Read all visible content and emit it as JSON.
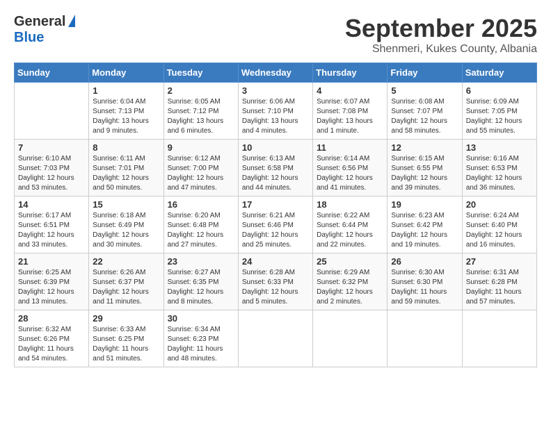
{
  "logo": {
    "general": "General",
    "blue": "Blue"
  },
  "title": "September 2025",
  "location": "Shenmeri, Kukes County, Albania",
  "weekdays": [
    "Sunday",
    "Monday",
    "Tuesday",
    "Wednesday",
    "Thursday",
    "Friday",
    "Saturday"
  ],
  "weeks": [
    [
      {
        "day": "",
        "info": ""
      },
      {
        "day": "1",
        "info": "Sunrise: 6:04 AM\nSunset: 7:13 PM\nDaylight: 13 hours\nand 9 minutes."
      },
      {
        "day": "2",
        "info": "Sunrise: 6:05 AM\nSunset: 7:12 PM\nDaylight: 13 hours\nand 6 minutes."
      },
      {
        "day": "3",
        "info": "Sunrise: 6:06 AM\nSunset: 7:10 PM\nDaylight: 13 hours\nand 4 minutes."
      },
      {
        "day": "4",
        "info": "Sunrise: 6:07 AM\nSunset: 7:08 PM\nDaylight: 13 hours\nand 1 minute."
      },
      {
        "day": "5",
        "info": "Sunrise: 6:08 AM\nSunset: 7:07 PM\nDaylight: 12 hours\nand 58 minutes."
      },
      {
        "day": "6",
        "info": "Sunrise: 6:09 AM\nSunset: 7:05 PM\nDaylight: 12 hours\nand 55 minutes."
      }
    ],
    [
      {
        "day": "7",
        "info": "Sunrise: 6:10 AM\nSunset: 7:03 PM\nDaylight: 12 hours\nand 53 minutes."
      },
      {
        "day": "8",
        "info": "Sunrise: 6:11 AM\nSunset: 7:01 PM\nDaylight: 12 hours\nand 50 minutes."
      },
      {
        "day": "9",
        "info": "Sunrise: 6:12 AM\nSunset: 7:00 PM\nDaylight: 12 hours\nand 47 minutes."
      },
      {
        "day": "10",
        "info": "Sunrise: 6:13 AM\nSunset: 6:58 PM\nDaylight: 12 hours\nand 44 minutes."
      },
      {
        "day": "11",
        "info": "Sunrise: 6:14 AM\nSunset: 6:56 PM\nDaylight: 12 hours\nand 41 minutes."
      },
      {
        "day": "12",
        "info": "Sunrise: 6:15 AM\nSunset: 6:55 PM\nDaylight: 12 hours\nand 39 minutes."
      },
      {
        "day": "13",
        "info": "Sunrise: 6:16 AM\nSunset: 6:53 PM\nDaylight: 12 hours\nand 36 minutes."
      }
    ],
    [
      {
        "day": "14",
        "info": "Sunrise: 6:17 AM\nSunset: 6:51 PM\nDaylight: 12 hours\nand 33 minutes."
      },
      {
        "day": "15",
        "info": "Sunrise: 6:18 AM\nSunset: 6:49 PM\nDaylight: 12 hours\nand 30 minutes."
      },
      {
        "day": "16",
        "info": "Sunrise: 6:20 AM\nSunset: 6:48 PM\nDaylight: 12 hours\nand 27 minutes."
      },
      {
        "day": "17",
        "info": "Sunrise: 6:21 AM\nSunset: 6:46 PM\nDaylight: 12 hours\nand 25 minutes."
      },
      {
        "day": "18",
        "info": "Sunrise: 6:22 AM\nSunset: 6:44 PM\nDaylight: 12 hours\nand 22 minutes."
      },
      {
        "day": "19",
        "info": "Sunrise: 6:23 AM\nSunset: 6:42 PM\nDaylight: 12 hours\nand 19 minutes."
      },
      {
        "day": "20",
        "info": "Sunrise: 6:24 AM\nSunset: 6:40 PM\nDaylight: 12 hours\nand 16 minutes."
      }
    ],
    [
      {
        "day": "21",
        "info": "Sunrise: 6:25 AM\nSunset: 6:39 PM\nDaylight: 12 hours\nand 13 minutes."
      },
      {
        "day": "22",
        "info": "Sunrise: 6:26 AM\nSunset: 6:37 PM\nDaylight: 12 hours\nand 11 minutes."
      },
      {
        "day": "23",
        "info": "Sunrise: 6:27 AM\nSunset: 6:35 PM\nDaylight: 12 hours\nand 8 minutes."
      },
      {
        "day": "24",
        "info": "Sunrise: 6:28 AM\nSunset: 6:33 PM\nDaylight: 12 hours\nand 5 minutes."
      },
      {
        "day": "25",
        "info": "Sunrise: 6:29 AM\nSunset: 6:32 PM\nDaylight: 12 hours\nand 2 minutes."
      },
      {
        "day": "26",
        "info": "Sunrise: 6:30 AM\nSunset: 6:30 PM\nDaylight: 11 hours\nand 59 minutes."
      },
      {
        "day": "27",
        "info": "Sunrise: 6:31 AM\nSunset: 6:28 PM\nDaylight: 11 hours\nand 57 minutes."
      }
    ],
    [
      {
        "day": "28",
        "info": "Sunrise: 6:32 AM\nSunset: 6:26 PM\nDaylight: 11 hours\nand 54 minutes."
      },
      {
        "day": "29",
        "info": "Sunrise: 6:33 AM\nSunset: 6:25 PM\nDaylight: 11 hours\nand 51 minutes."
      },
      {
        "day": "30",
        "info": "Sunrise: 6:34 AM\nSunset: 6:23 PM\nDaylight: 11 hours\nand 48 minutes."
      },
      {
        "day": "",
        "info": ""
      },
      {
        "day": "",
        "info": ""
      },
      {
        "day": "",
        "info": ""
      },
      {
        "day": "",
        "info": ""
      }
    ]
  ]
}
